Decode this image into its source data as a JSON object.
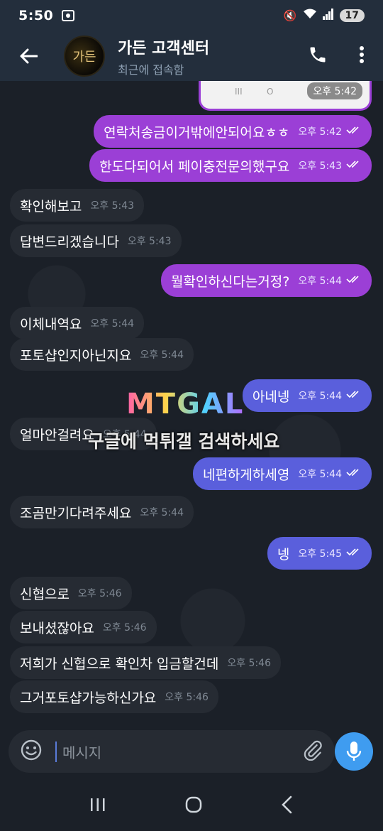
{
  "status": {
    "time": "5:50",
    "battery": "17"
  },
  "header": {
    "title": "가든 고객센터",
    "subtitle": "최근에 접속함",
    "avatar_text": "가든"
  },
  "top_card": {
    "time": "오후 5:42"
  },
  "messages": [
    {
      "dir": "out",
      "color": "#9b3fd6",
      "text": "연락처송금이거밖에안되어요ㅎㅎ",
      "time": "오후 5:42"
    },
    {
      "dir": "out",
      "color": "#9b3fd6",
      "text": "한도다되어서 페이충전문의했구요",
      "time": "오후 5:43"
    },
    {
      "dir": "in",
      "text": "확인해보고",
      "time": "오후 5:43"
    },
    {
      "dir": "in",
      "text": "답변드리겠습니다",
      "time": "오후 5:43"
    },
    {
      "dir": "out",
      "color": "#9b3fd6",
      "text": "뭘확인하신다는거정?",
      "time": "오후 5:44"
    },
    {
      "dir": "in",
      "text": "이체내역요",
      "time": "오후 5:44"
    },
    {
      "dir": "in",
      "text": "포토샵인지아닌지요",
      "time": "오후 5:44"
    },
    {
      "dir": "out",
      "color": "#5a5fdc",
      "text": "아네넹",
      "time": "오후 5:44"
    },
    {
      "dir": "in",
      "text": "얼마안걸려요",
      "time": "오후 5:44"
    },
    {
      "dir": "out",
      "color": "#5a5fdc",
      "text": "네편하게하세영",
      "time": "오후 5:44"
    },
    {
      "dir": "in",
      "text": "조곰만기다려주세요",
      "time": "오후 5:44"
    },
    {
      "dir": "out",
      "color": "#5a5fdc",
      "text": "넹",
      "time": "오후 5:45"
    },
    {
      "dir": "in",
      "text": "신협으로",
      "time": "오후 5:46"
    },
    {
      "dir": "in",
      "text": "보내셨잖아요",
      "time": "오후 5:46"
    },
    {
      "dir": "in",
      "text": "저희가 신협으로 확인차 입금할건데",
      "time": "오후 5:46"
    },
    {
      "dir": "in",
      "text": "그거포토샵가능하신가요",
      "time": "오후 5:46"
    }
  ],
  "watermark": {
    "logo": "MTGAL",
    "text": "구글에 먹튀갤 검색하세요"
  },
  "input": {
    "placeholder": "메시지"
  },
  "colors": {
    "purple_bubble": "#9b3fd6",
    "blue_bubble": "#5a5fdc",
    "incoming_bubble": "#262b33",
    "header": "#232e3c",
    "mic": "#3f9cf0"
  }
}
